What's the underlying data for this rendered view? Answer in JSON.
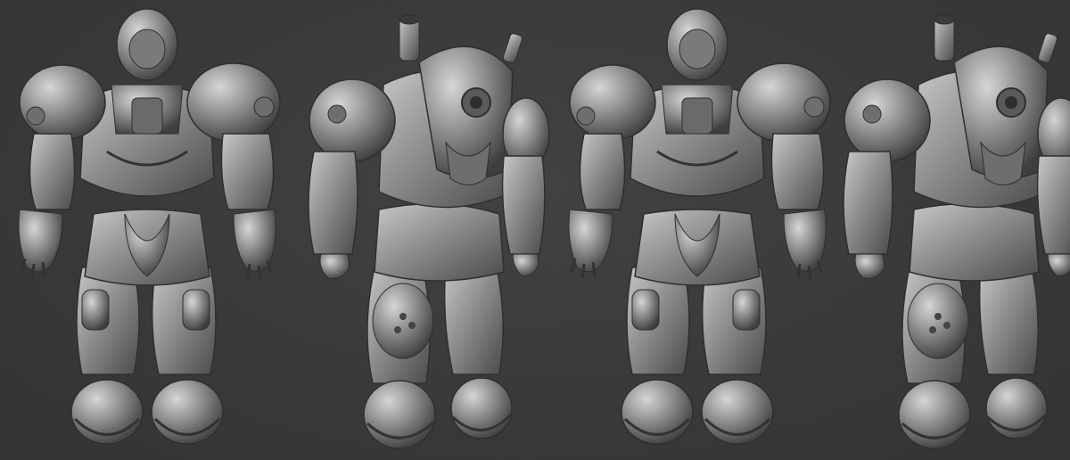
{
  "scene": {
    "background_color": "#3a3a3a",
    "material_color": "#9a9a9a",
    "wire_color": "#2a2a2a",
    "views": [
      {
        "name": "front",
        "shading": "smooth"
      },
      {
        "name": "three-quarter",
        "shading": "smooth"
      },
      {
        "name": "front",
        "shading": "wireframe"
      },
      {
        "name": "three-quarter",
        "shading": "wireframe"
      }
    ]
  }
}
